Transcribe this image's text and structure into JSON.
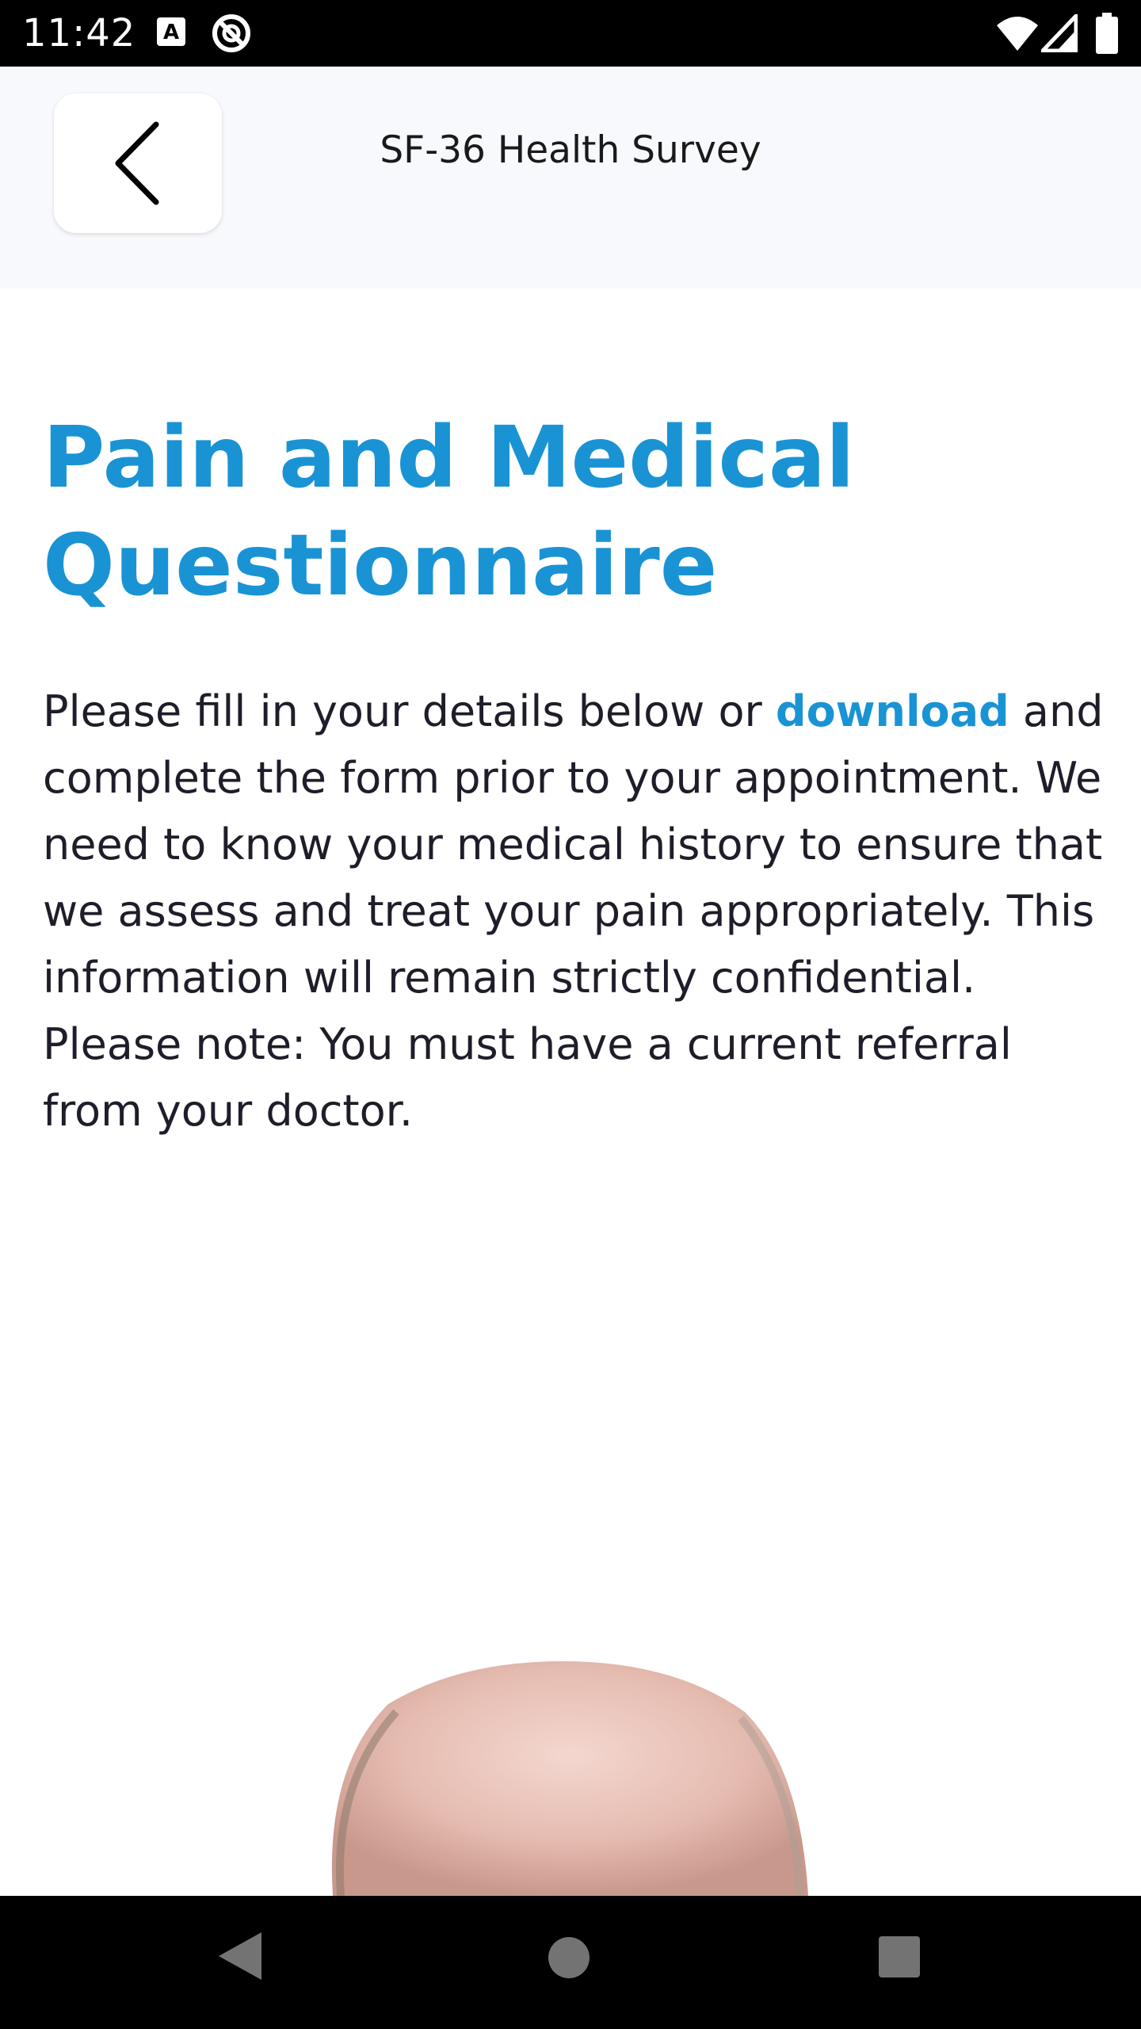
{
  "status": {
    "time": "11:42"
  },
  "header": {
    "title": "SF-36 Health Survey"
  },
  "content": {
    "title_line1": "Pain and Medical",
    "title_line2": "Questionnaire",
    "intro_before_link": "Please fill in your details below or ",
    "intro_link": "download",
    "intro_after_link": " and complete the form prior to your appointment. We need to know your medical history to ensure that we assess and treat your pain appropriately. This information will remain strictly confidential. Please note: You must have a current referral from your doctor."
  },
  "colors": {
    "accent": "#1a93d4",
    "header_bg": "#f8f9fc",
    "text": "#1e1e2a"
  },
  "icons": [
    "font-a-icon",
    "no-sync-icon",
    "wifi-icon",
    "signal-icon",
    "battery-icon",
    "back-chevron-icon",
    "nav-back-icon",
    "nav-home-icon",
    "nav-recents-icon"
  ]
}
